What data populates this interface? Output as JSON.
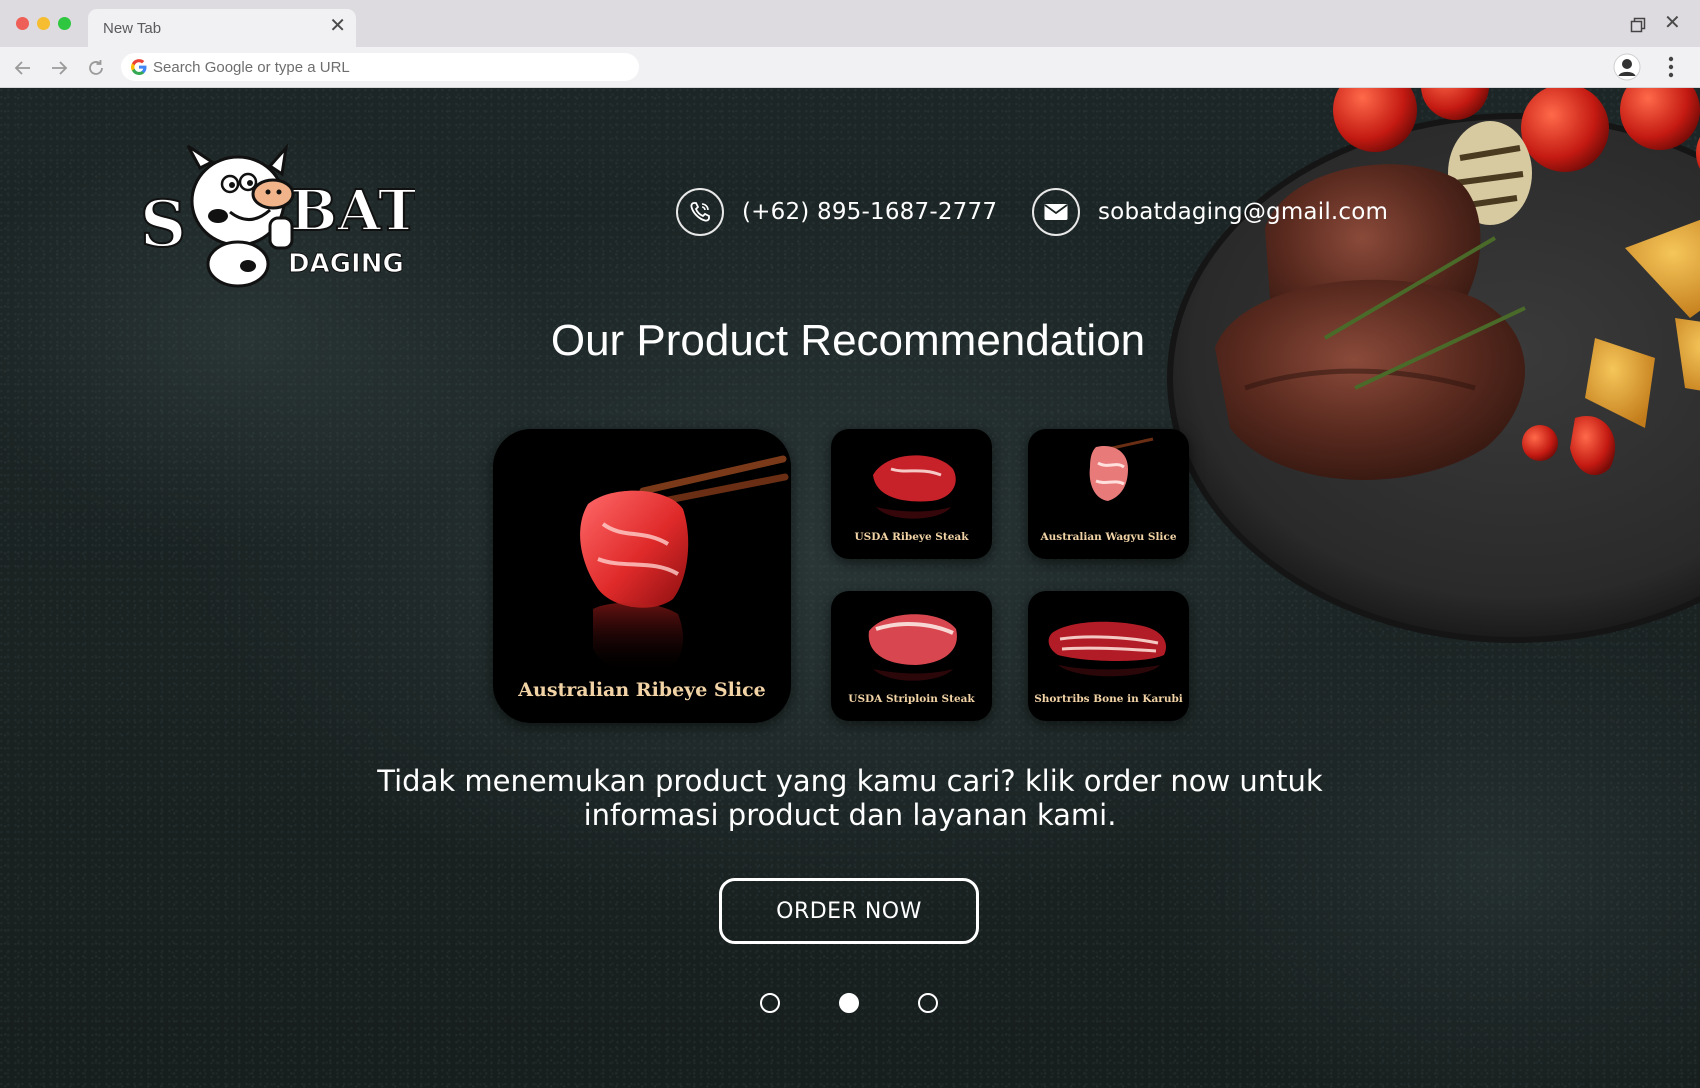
{
  "browser": {
    "tab_title": "New Tab",
    "tab_close": "✕",
    "window_close": "✕",
    "omnibox_placeholder": "Search Google or type a URL"
  },
  "header": {
    "logo_text_top": "S BAT",
    "logo_text_bottom": "DAGING",
    "phone": "(+62) 895-1687-2777",
    "email": "sobatdaging@gmail.com"
  },
  "main": {
    "title": "Our Product Recommendation",
    "products": [
      {
        "label": "Australian Ribeye Slice",
        "featured": true
      },
      {
        "label": "USDA Ribeye Steak"
      },
      {
        "label": "Australian Wagyu Slice"
      },
      {
        "label": "USDA Striploin Steak"
      },
      {
        "label": "Shortribs Bone in Karubi"
      }
    ],
    "note_line1": "Tidak menemukan product yang kamu cari? klik order now untuk",
    "note_line2": "informasi product dan layanan kami.",
    "order_button": "ORDER NOW",
    "carousel": {
      "pages": 3,
      "active": 2
    }
  },
  "colors": {
    "background": "#1c2424",
    "label_gold": "#f2d3a6",
    "text": "#ffffff"
  }
}
